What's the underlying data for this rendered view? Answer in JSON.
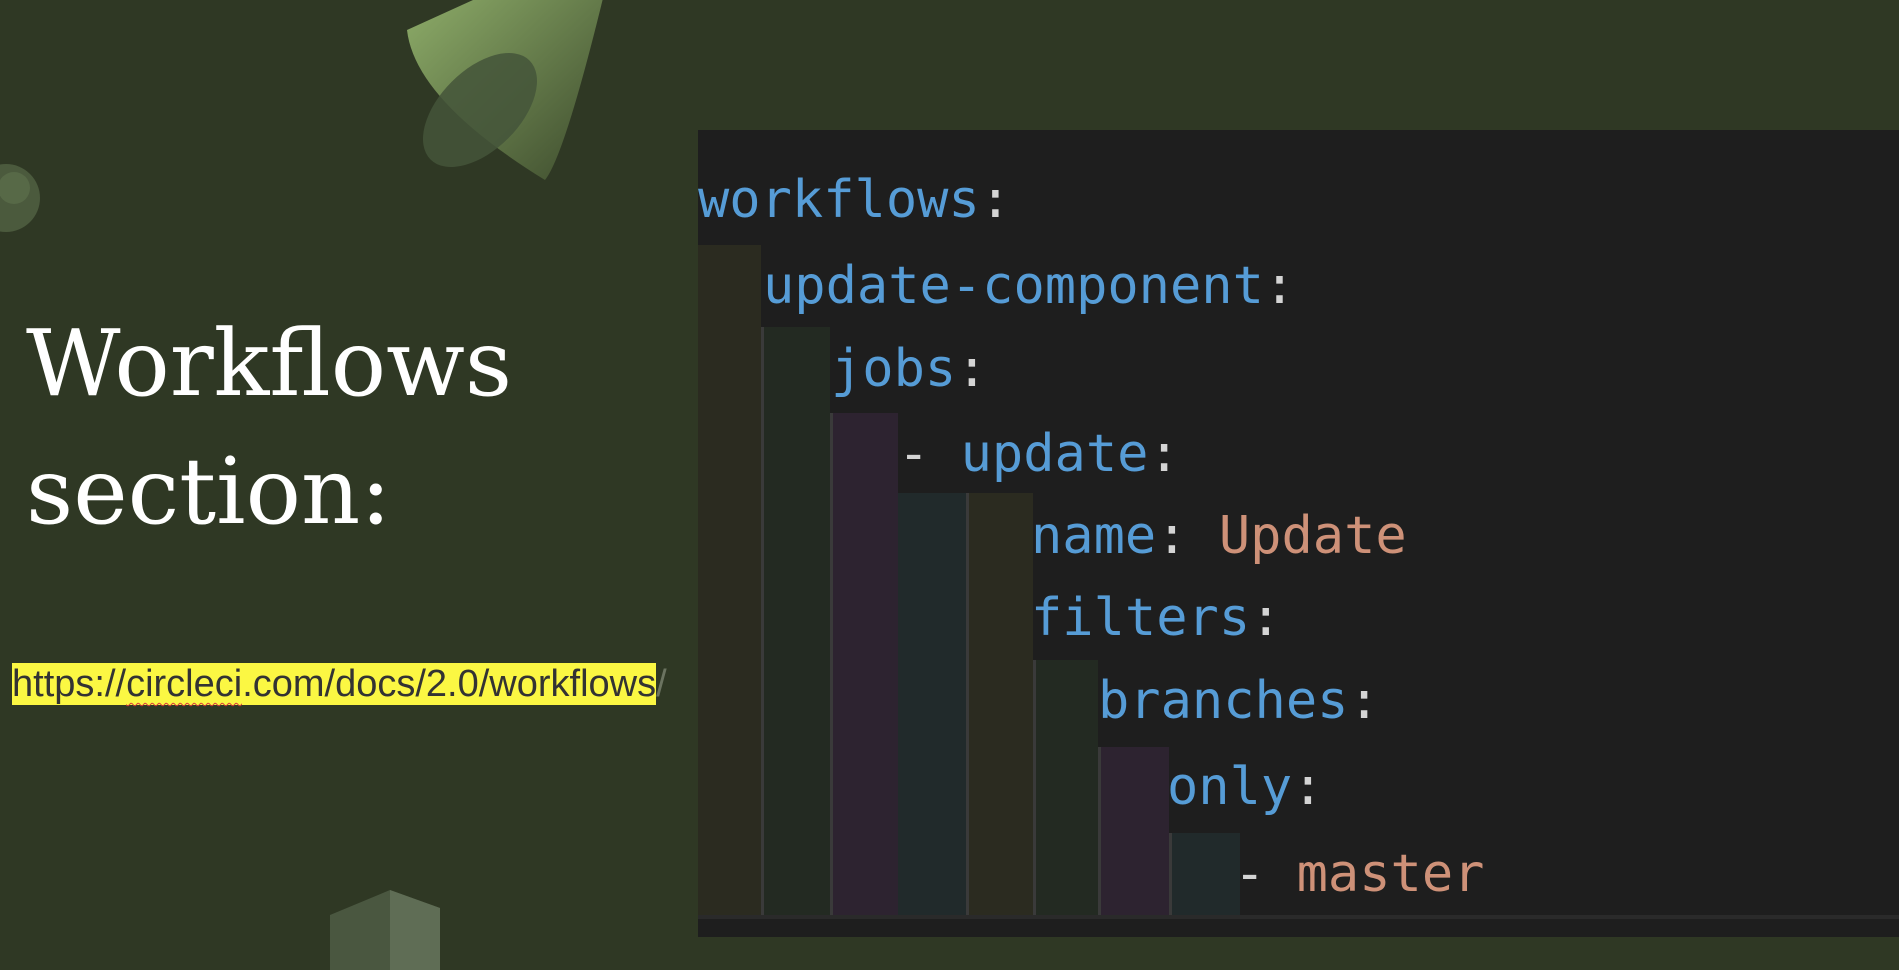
{
  "slide": {
    "title_line1": "Workflows",
    "title_line2": "section:"
  },
  "link": {
    "part1": "https://",
    "part2": "circleci",
    "part3": ".com/docs/2.0/workflows",
    "trailing": "/"
  },
  "code": {
    "lines": [
      {
        "key": "workflows",
        "colon": ":"
      },
      {
        "key": "update-component",
        "colon": ":"
      },
      {
        "key": "jobs",
        "colon": ":"
      },
      {
        "dash": "- ",
        "key": "update",
        "colon": ":"
      },
      {
        "key": "name",
        "colon": ": ",
        "value": "Update"
      },
      {
        "key": "filters",
        "colon": ":"
      },
      {
        "key": "branches",
        "colon": ":"
      },
      {
        "key": "only",
        "colon": ":"
      },
      {
        "dash": "- ",
        "value": "master"
      }
    ]
  },
  "colors": {
    "slide_background": "#2f3824",
    "code_background": "#1e1e1e",
    "yaml_key": "#569cd6",
    "yaml_string": "#ce9178",
    "punctuation": "#d4d4d4",
    "link_highlight": "#fbf743"
  }
}
